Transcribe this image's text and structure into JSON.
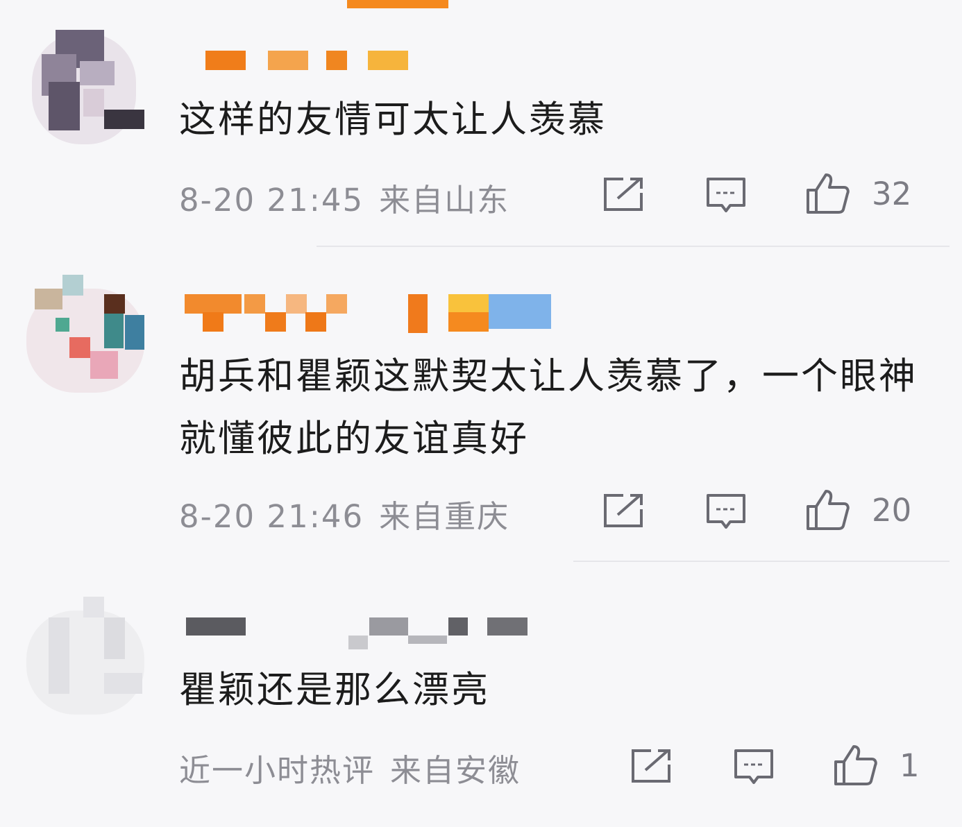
{
  "comments": [
    {
      "text": "这样的友情可太让人羡慕",
      "time": "8-20 21:45",
      "location": "来自山东",
      "likes": "32"
    },
    {
      "text": "胡兵和瞿颖这默契太让人羡慕了，一个眼神就懂彼此的友谊真好",
      "time": "8-20 21:46",
      "location": "来自重庆",
      "likes": "20"
    },
    {
      "text": "瞿颖还是那么漂亮",
      "time": "近一小时热评",
      "location": "来自安徽",
      "likes": "1"
    }
  ]
}
